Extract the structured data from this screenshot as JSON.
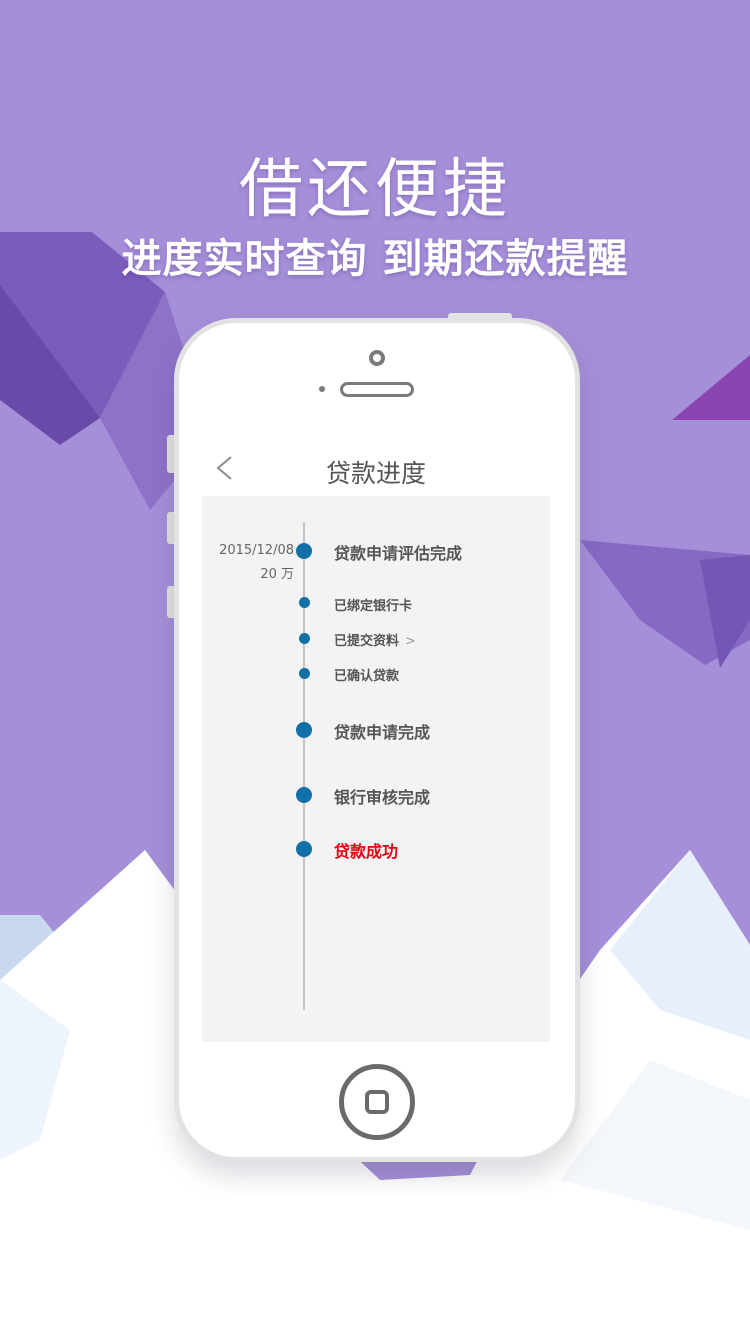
{
  "promo": {
    "title": "借还便捷",
    "subtitle": "进度实时查询 到期还款提醒"
  },
  "app": {
    "nav_title": "贷款进度",
    "back_icon": "chevron-left-icon",
    "progress": {
      "date": "2015/12/08",
      "amount": "20 万",
      "steps": [
        {
          "label": "贷款申请评估完成",
          "level": "major"
        },
        {
          "label": "已绑定银行卡",
          "level": "minor"
        },
        {
          "label": "已提交资料",
          "level": "minor",
          "chevron": ">"
        },
        {
          "label": "已确认贷款",
          "level": "minor"
        },
        {
          "label": "贷款申请完成",
          "level": "major"
        },
        {
          "label": "银行审核完成",
          "level": "major"
        },
        {
          "label": "贷款成功",
          "level": "major",
          "status_color": "#e60012"
        }
      ]
    }
  },
  "colors": {
    "background": "#a58fd8",
    "accent_dot": "#1270a8",
    "success_text": "#e60012"
  }
}
